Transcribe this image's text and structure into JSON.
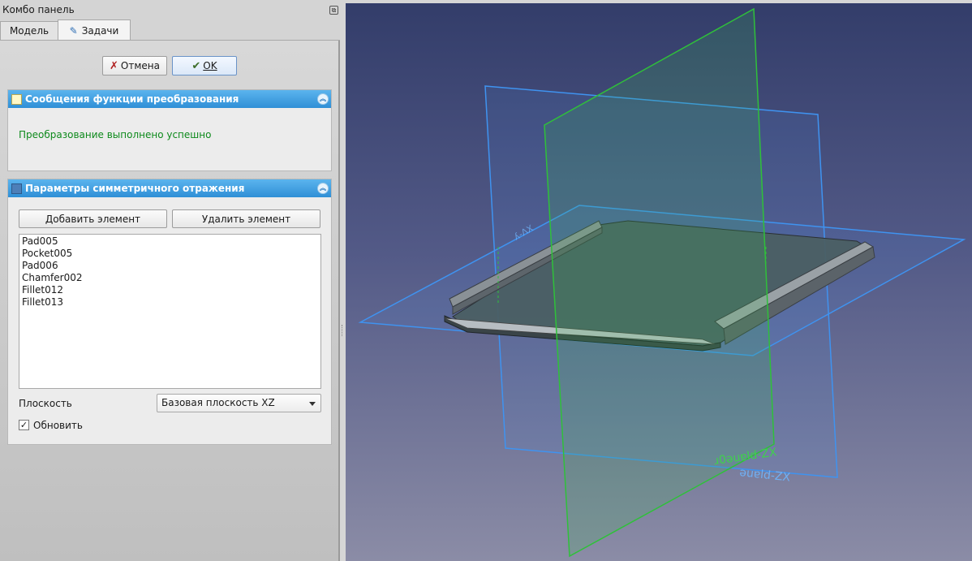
{
  "combo": {
    "title": "Комбо панель",
    "tabs": [
      {
        "label": "Модель"
      },
      {
        "label": "Задачи"
      }
    ]
  },
  "dialog": {
    "cancel_label": "Отмена",
    "ok_label": "OK"
  },
  "messages": {
    "title": "Сообщения функции преобразования",
    "text": "Преобразование выполнено успешно"
  },
  "mirror": {
    "title": "Параметры симметричного отражения",
    "add_label": "Добавить элемент",
    "remove_label": "Удалить элемент",
    "features": [
      "Pad005",
      "Pocket005",
      "Pad006",
      "Chamfer002",
      "Fillet012",
      "Fillet013"
    ],
    "plane_label": "Плоскость",
    "plane_value": "Базовая плоскость XZ",
    "refresh_label": "Обновить",
    "refresh_checked": true
  },
  "view3d": {
    "colors": {
      "xy_plane": "#3f93f0",
      "yz_plane": "#2fc03a"
    }
  }
}
